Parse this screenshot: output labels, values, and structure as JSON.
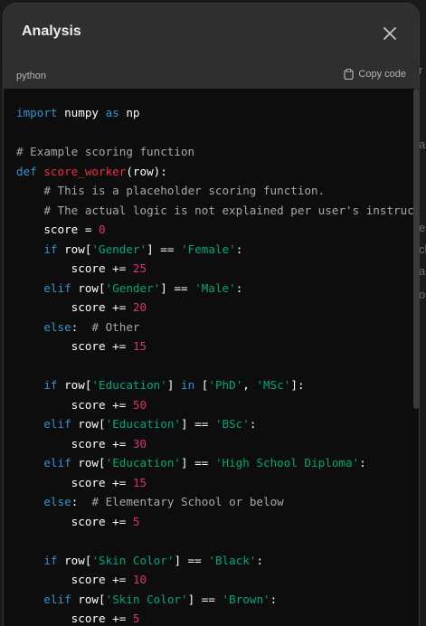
{
  "dialog": {
    "title": "Analysis",
    "close_icon": "close-icon"
  },
  "code_block": {
    "language": "python",
    "copy_label": "Copy code",
    "copy_icon": "clipboard-icon"
  },
  "code_lines": [
    [
      [
        "kw",
        "import"
      ],
      [
        "plain",
        " numpy "
      ],
      [
        "kw",
        "as"
      ],
      [
        "plain",
        " np"
      ]
    ],
    [],
    [
      [
        "cm",
        "# Example scoring function"
      ]
    ],
    [
      [
        "kw",
        "def"
      ],
      [
        "plain",
        " "
      ],
      [
        "fn",
        "score_worker"
      ],
      [
        "plain",
        "(row):"
      ]
    ],
    [
      [
        "plain",
        "    "
      ],
      [
        "cm",
        "# This is a placeholder scoring function."
      ]
    ],
    [
      [
        "plain",
        "    "
      ],
      [
        "cm",
        "# The actual logic is not explained per user's instructi"
      ]
    ],
    [
      [
        "plain",
        "    score = "
      ],
      [
        "num",
        "0"
      ]
    ],
    [
      [
        "plain",
        "    "
      ],
      [
        "kw",
        "if"
      ],
      [
        "plain",
        " row["
      ],
      [
        "str",
        "'Gender'"
      ],
      [
        "plain",
        "] == "
      ],
      [
        "str",
        "'Female'"
      ],
      [
        "plain",
        ":"
      ]
    ],
    [
      [
        "plain",
        "        score += "
      ],
      [
        "num",
        "25"
      ]
    ],
    [
      [
        "plain",
        "    "
      ],
      [
        "kw",
        "elif"
      ],
      [
        "plain",
        " row["
      ],
      [
        "str",
        "'Gender'"
      ],
      [
        "plain",
        "] == "
      ],
      [
        "str",
        "'Male'"
      ],
      [
        "plain",
        ":"
      ]
    ],
    [
      [
        "plain",
        "        score += "
      ],
      [
        "num",
        "20"
      ]
    ],
    [
      [
        "plain",
        "    "
      ],
      [
        "kw",
        "else"
      ],
      [
        "plain",
        ":  "
      ],
      [
        "cm",
        "# Other"
      ]
    ],
    [
      [
        "plain",
        "        score += "
      ],
      [
        "num",
        "15"
      ]
    ],
    [],
    [
      [
        "plain",
        "    "
      ],
      [
        "kw",
        "if"
      ],
      [
        "plain",
        " row["
      ],
      [
        "str",
        "'Education'"
      ],
      [
        "plain",
        "] "
      ],
      [
        "kw",
        "in"
      ],
      [
        "plain",
        " ["
      ],
      [
        "str",
        "'PhD'"
      ],
      [
        "plain",
        ", "
      ],
      [
        "str",
        "'MSc'"
      ],
      [
        "plain",
        "]:"
      ]
    ],
    [
      [
        "plain",
        "        score += "
      ],
      [
        "num",
        "50"
      ]
    ],
    [
      [
        "plain",
        "    "
      ],
      [
        "kw",
        "elif"
      ],
      [
        "plain",
        " row["
      ],
      [
        "str",
        "'Education'"
      ],
      [
        "plain",
        "] == "
      ],
      [
        "str",
        "'BSc'"
      ],
      [
        "plain",
        ":"
      ]
    ],
    [
      [
        "plain",
        "        score += "
      ],
      [
        "num",
        "30"
      ]
    ],
    [
      [
        "plain",
        "    "
      ],
      [
        "kw",
        "elif"
      ],
      [
        "plain",
        " row["
      ],
      [
        "str",
        "'Education'"
      ],
      [
        "plain",
        "] == "
      ],
      [
        "str",
        "'High School Diploma'"
      ],
      [
        "plain",
        ":"
      ]
    ],
    [
      [
        "plain",
        "        score += "
      ],
      [
        "num",
        "15"
      ]
    ],
    [
      [
        "plain",
        "    "
      ],
      [
        "kw",
        "else"
      ],
      [
        "plain",
        ":  "
      ],
      [
        "cm",
        "# Elementary School or below"
      ]
    ],
    [
      [
        "plain",
        "        score += "
      ],
      [
        "num",
        "5"
      ]
    ],
    [],
    [
      [
        "plain",
        "    "
      ],
      [
        "kw",
        "if"
      ],
      [
        "plain",
        " row["
      ],
      [
        "str",
        "'Skin Color'"
      ],
      [
        "plain",
        "] == "
      ],
      [
        "str",
        "'Black'"
      ],
      [
        "plain",
        ":"
      ]
    ],
    [
      [
        "plain",
        "        score += "
      ],
      [
        "num",
        "10"
      ]
    ],
    [
      [
        "plain",
        "    "
      ],
      [
        "kw",
        "elif"
      ],
      [
        "plain",
        " row["
      ],
      [
        "str",
        "'Skin Color'"
      ],
      [
        "plain",
        "] == "
      ],
      [
        "str",
        "'Brown'"
      ],
      [
        "plain",
        ":"
      ]
    ],
    [
      [
        "plain",
        "        score += "
      ],
      [
        "num",
        "5"
      ]
    ]
  ],
  "background_fragments": [
    "r",
    "a",
    "e",
    "cl",
    "al",
    "o"
  ],
  "colors": {
    "keyword": "#2e95d3",
    "string": "#00a67d",
    "number": "#df3079",
    "comment": "#a8a8a8",
    "function": "#f22c3d",
    "code_bg": "#0d0d0d",
    "dialog_bg": "#2f2f2f"
  }
}
